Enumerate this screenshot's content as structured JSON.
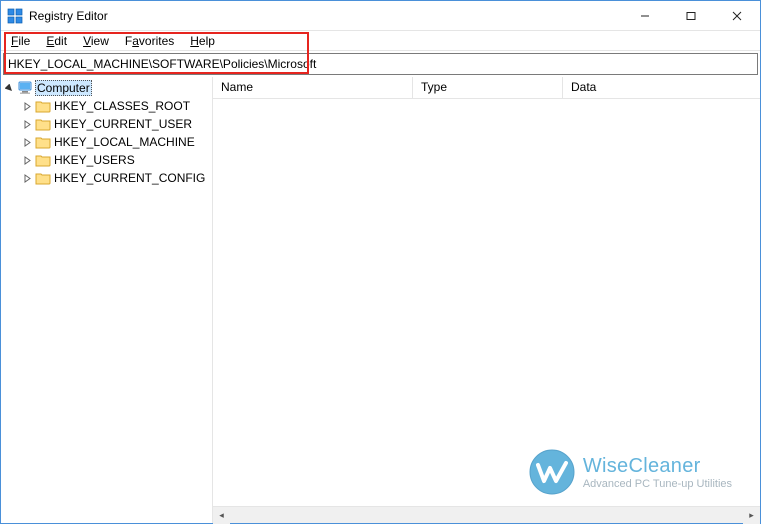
{
  "window": {
    "title": "Registry Editor"
  },
  "menu": {
    "file": "File",
    "edit": "Edit",
    "view": "View",
    "favorites": "Favorites",
    "help": "Help"
  },
  "address": {
    "path": "HKEY_LOCAL_MACHINE\\SOFTWARE\\Policies\\Microsoft"
  },
  "tree": {
    "root": "Computer",
    "hives": [
      "HKEY_CLASSES_ROOT",
      "HKEY_CURRENT_USER",
      "HKEY_LOCAL_MACHINE",
      "HKEY_USERS",
      "HKEY_CURRENT_CONFIG"
    ]
  },
  "columns": {
    "name": "Name",
    "type": "Type",
    "data": "Data"
  },
  "watermark": {
    "brand": "WiseCleaner",
    "tagline": "Advanced PC Tune-up Utilities"
  }
}
